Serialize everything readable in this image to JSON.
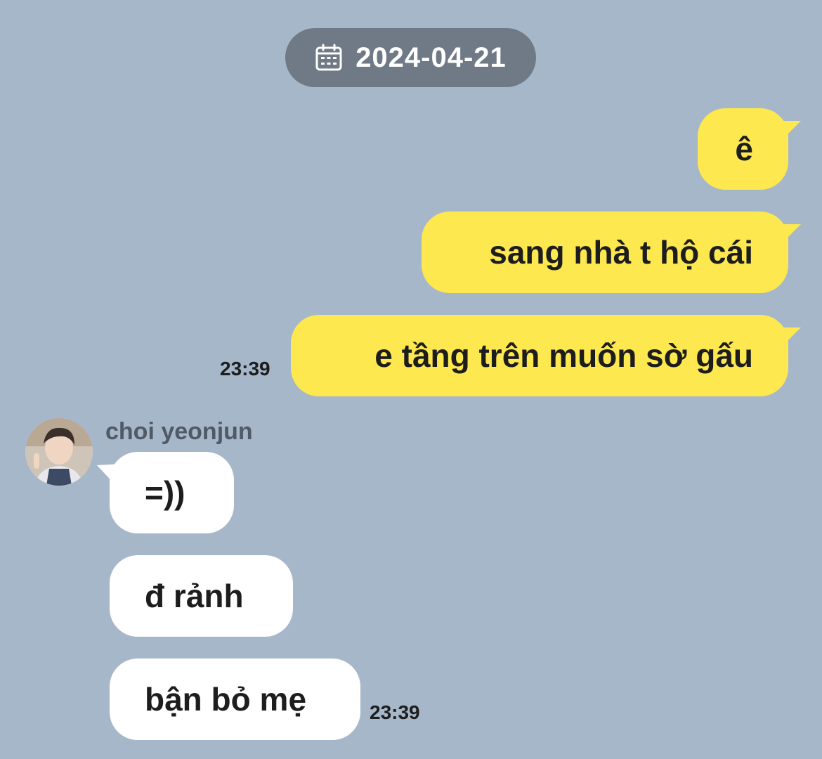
{
  "date_header": {
    "icon": "calendar-icon",
    "date": "2024-04-21"
  },
  "colors": {
    "background": "#a7b7ca",
    "outgoing_bubble": "#fde84f",
    "incoming_bubble": "#ffffff",
    "date_pill": "#6f7a86"
  },
  "outgoing": {
    "messages": [
      {
        "text": "ê"
      },
      {
        "text": "sang nhà t hộ cái"
      },
      {
        "text": "e tầng trên muốn sờ gấu"
      }
    ],
    "time": "23:39"
  },
  "incoming": {
    "sender": "choi yeonjun",
    "avatar": "avatar-photo",
    "messages": [
      {
        "text": "=))"
      },
      {
        "text": "đ rảnh"
      },
      {
        "text": "bận bỏ mẹ"
      }
    ],
    "time": "23:39"
  }
}
